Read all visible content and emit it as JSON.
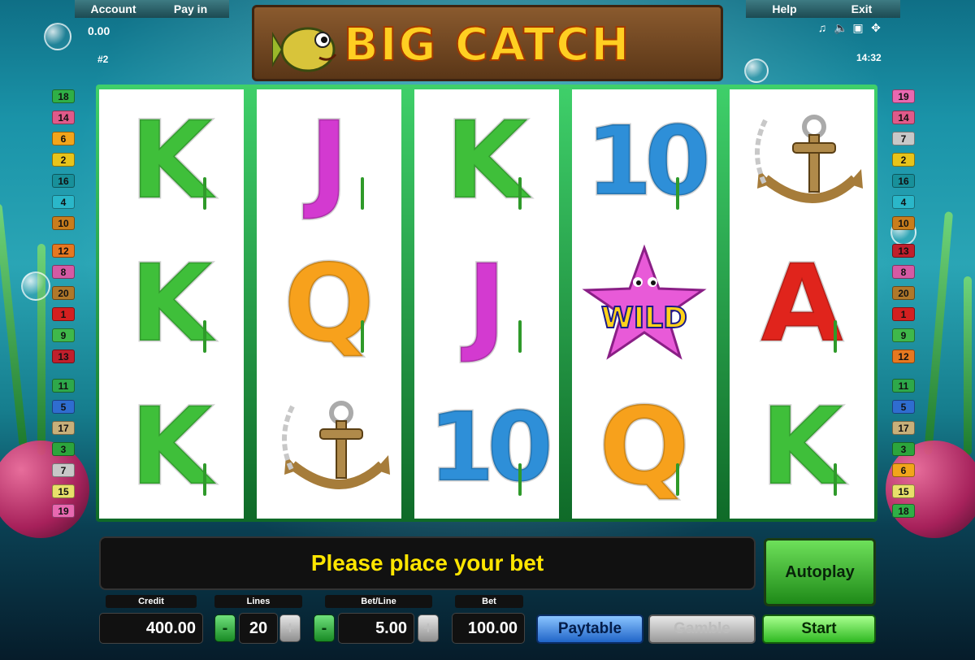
{
  "top_bar": {
    "account_label": "Account",
    "payin_label": "Pay in",
    "help_label": "Help",
    "exit_label": "Exit",
    "balance": "0.00",
    "game_number": "#2",
    "clock": "14:32"
  },
  "toolbar_icons": [
    "music-icon",
    "sound-icon",
    "window-icon",
    "fullscreen-icon"
  ],
  "logo": {
    "title": "BIG CATCH"
  },
  "line_indicators": {
    "left": [
      {
        "n": "18",
        "color": "#2faf46"
      },
      {
        "n": "14",
        "color": "#e05a8a"
      },
      {
        "n": "6",
        "color": "#f2a51b"
      },
      {
        "n": "2",
        "color": "#e8c41a"
      },
      {
        "n": "16",
        "color": "#18909a"
      },
      {
        "n": "4",
        "color": "#2ab7c9"
      },
      {
        "n": "10",
        "color": "#c97d1c"
      },
      {
        "n": "12",
        "color": "#e67820"
      },
      {
        "n": "8",
        "color": "#d55aa4"
      },
      {
        "n": "20",
        "color": "#b0782a"
      },
      {
        "n": "1",
        "color": "#d42020"
      },
      {
        "n": "9",
        "color": "#3fb84a"
      },
      {
        "n": "13",
        "color": "#c01f2c"
      },
      {
        "n": "11",
        "color": "#2ea84a"
      },
      {
        "n": "5",
        "color": "#2f6dd0"
      },
      {
        "n": "17",
        "color": "#c8b07a"
      },
      {
        "n": "3",
        "color": "#2ca53c"
      },
      {
        "n": "7",
        "color": "#c8c8c8"
      },
      {
        "n": "15",
        "color": "#e8e06a"
      },
      {
        "n": "19",
        "color": "#e868b0"
      }
    ],
    "right": [
      {
        "n": "19",
        "color": "#e868b0"
      },
      {
        "n": "14",
        "color": "#e05a8a"
      },
      {
        "n": "7",
        "color": "#c8c8c8"
      },
      {
        "n": "2",
        "color": "#e8c41a"
      },
      {
        "n": "16",
        "color": "#18909a"
      },
      {
        "n": "4",
        "color": "#2ab7c9"
      },
      {
        "n": "10",
        "color": "#c97d1c"
      },
      {
        "n": "13",
        "color": "#c01f2c"
      },
      {
        "n": "8",
        "color": "#d55aa4"
      },
      {
        "n": "20",
        "color": "#b0782a"
      },
      {
        "n": "1",
        "color": "#d42020"
      },
      {
        "n": "9",
        "color": "#3fb84a"
      },
      {
        "n": "12",
        "color": "#e67820"
      },
      {
        "n": "11",
        "color": "#2ea84a"
      },
      {
        "n": "5",
        "color": "#2f6dd0"
      },
      {
        "n": "17",
        "color": "#c8b07a"
      },
      {
        "n": "3",
        "color": "#2ca53c"
      },
      {
        "n": "6",
        "color": "#f2a51b"
      },
      {
        "n": "15",
        "color": "#e8e06a"
      },
      {
        "n": "18",
        "color": "#2faf46"
      }
    ]
  },
  "reels": [
    [
      "K",
      "K",
      "K"
    ],
    [
      "J",
      "Q",
      "anchor"
    ],
    [
      "K",
      "J",
      "10"
    ],
    [
      "10",
      "WILD",
      "Q"
    ],
    [
      "anchor",
      "A",
      "K"
    ]
  ],
  "symbol_colors": {
    "K": "#3fbf3a",
    "J": "#d33ad0",
    "Q": "#f7a11c",
    "10": "#2e8fd8",
    "A": "#e0241c"
  },
  "message": "Please place your bet",
  "controls": {
    "credit_label": "Credit",
    "credit_value": "400.00",
    "lines_label": "Lines",
    "lines_value": "20",
    "betline_label": "Bet/Line",
    "betline_value": "5.00",
    "bet_label": "Bet",
    "bet_value": "100.00",
    "minus": "-",
    "plus": "+",
    "paytable_label": "Paytable",
    "gamble_label": "Gamble",
    "start_label": "Start",
    "autoplay_label": "Autoplay"
  }
}
